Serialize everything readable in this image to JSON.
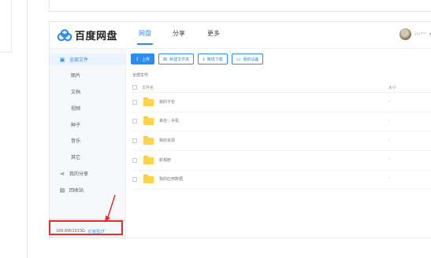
{
  "header": {
    "logo_text": "百度网盘",
    "tabs": [
      {
        "label": "网盘",
        "active": true
      },
      {
        "label": "分享",
        "active": false
      },
      {
        "label": "更多",
        "active": false
      }
    ],
    "username": "vn**",
    "user_dropdown": "▾"
  },
  "sidebar": {
    "items": [
      {
        "label": "全部文件",
        "icon": "file-icon",
        "active": true
      },
      {
        "label": "图片",
        "sub": true
      },
      {
        "label": "文档",
        "sub": true
      },
      {
        "label": "视频",
        "sub": true
      },
      {
        "label": "种子",
        "sub": true
      },
      {
        "label": "音乐",
        "sub": true
      },
      {
        "label": "其它",
        "sub": true
      },
      {
        "label": "我的分享",
        "icon": "share-icon"
      },
      {
        "label": "回收站",
        "icon": "trash-icon"
      }
    ],
    "storage_text": "166.6M/1033G",
    "storage_fill": 0.0002,
    "expand_text": "扩容至2T"
  },
  "toolbar": {
    "upload": "上传",
    "new_folder": "新建文件夹",
    "offline_download": "离线下载",
    "my_devices": "我的设备"
  },
  "breadcrumb": "全部文件",
  "table": {
    "col_name": "文件名",
    "col_size": "大小",
    "rows": [
      {
        "name": "我的卡包",
        "size": "-"
      },
      {
        "name": "来自：手机",
        "size": "-"
      },
      {
        "name": "我的资源",
        "size": "-"
      },
      {
        "name": "新相册",
        "size": "-"
      },
      {
        "name": "我的应用数据",
        "size": "-"
      }
    ]
  },
  "colors": {
    "accent": "#2b8cf2",
    "folder": "#ffd24d",
    "highlight": "#e03030"
  }
}
